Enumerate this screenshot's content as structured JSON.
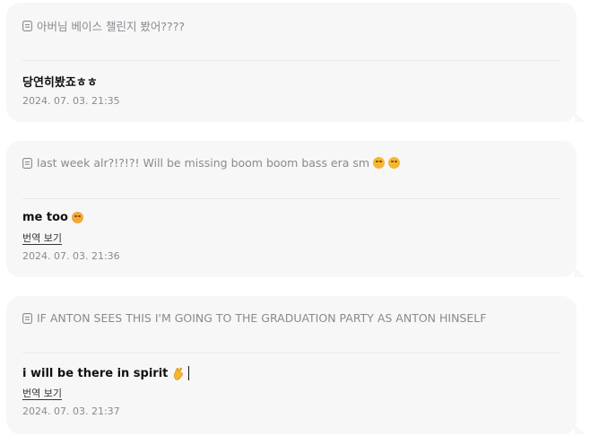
{
  "comments": [
    {
      "quote": "아버님 베이스 챌린지 봤어????",
      "reply": "당연히봤죠ㅎㅎ",
      "time": "2024. 07. 03. 21:35"
    },
    {
      "quote": "last week alr?!?!?! Will be missing boom boom bass era sm",
      "reply": "me too",
      "translate_label": "번역 보기",
      "time": "2024. 07. 03. 21:36"
    },
    {
      "quote": "IF ANTON SEES THIS I'M GOING TO THE GRADUATION PARTY AS ANTON HINSELF",
      "reply": "i will be there in spirit",
      "translate_label": "번역 보기",
      "time": "2024. 07. 03. 21:37"
    }
  ],
  "icons": {
    "quote": "document-icon",
    "sad_face": "pensive-face-emoji",
    "crying_face": "crying-face-emoji",
    "fingers_crossed": "crossed-fingers-emoji"
  },
  "colors": {
    "card_bg": "#f7f7f8",
    "muted_text": "#8a8a8f"
  }
}
